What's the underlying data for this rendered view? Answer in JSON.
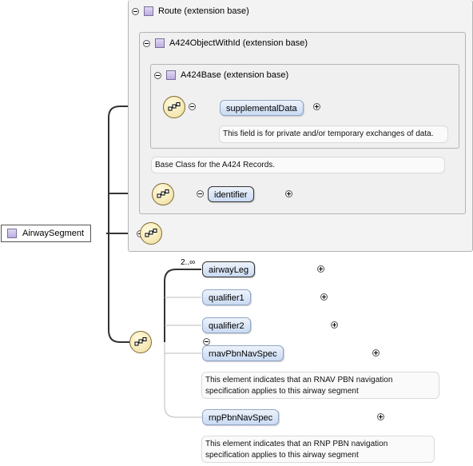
{
  "base_types": {
    "route": "Route (extension base)",
    "object_with_id": "A424ObjectWithId (extension base)",
    "a424_base": "A424Base (extension base)"
  },
  "root_element": "AirwaySegment",
  "elements": {
    "supplemental_data": "supplementalData",
    "supplemental_doc": "This field is for private and/or temporary exchanges of data.",
    "base_doc": "Base Class for the A424 Records.",
    "identifier": "identifier",
    "airway_leg": "airwayLeg",
    "airway_leg_card": "2..∞",
    "qualifier1": "qualifier1",
    "qualifier2": "qualifier2",
    "rnav": "rnavPbnNavSpec",
    "rnav_doc": "This element indicates that an RNAV PBN navigation specification applies to this airway segment",
    "rnp": "rnpPbnNavSpec",
    "rnp_doc": "This element indicates that an RNP PBN navigation specification applies to this airway segment"
  }
}
